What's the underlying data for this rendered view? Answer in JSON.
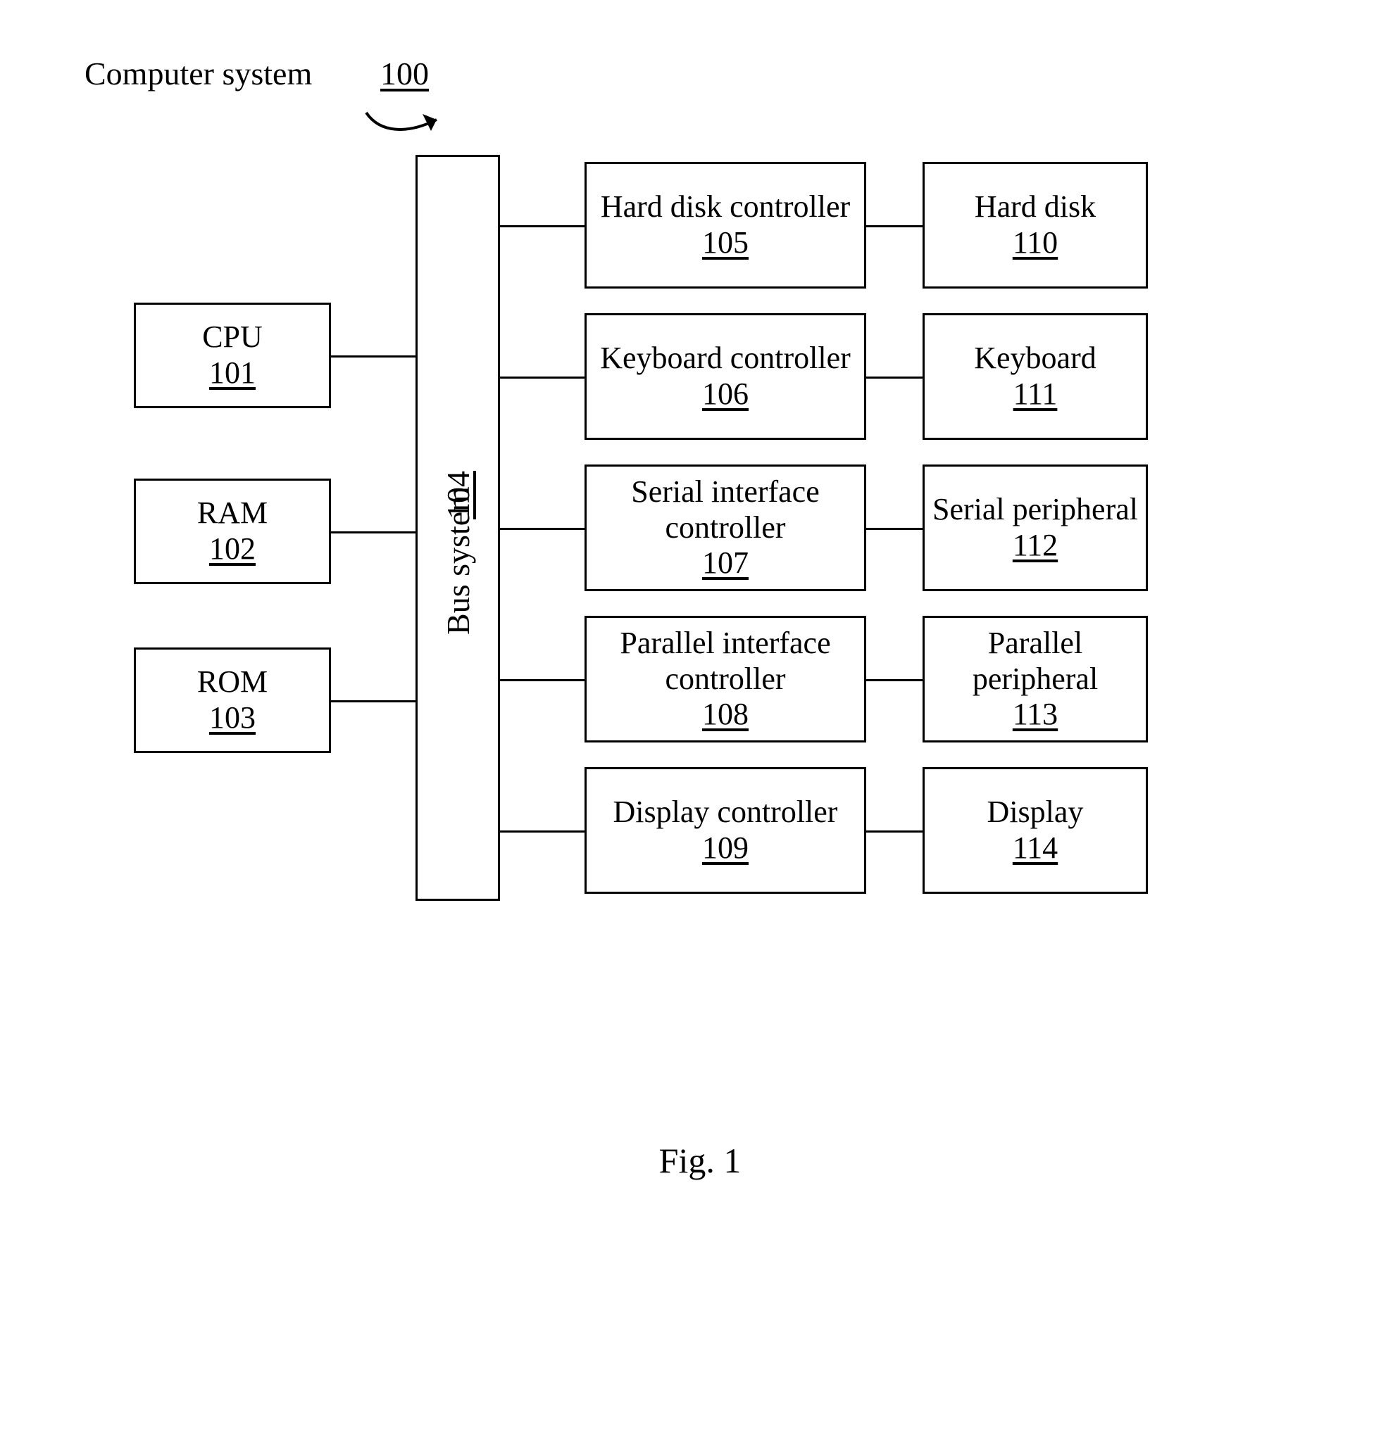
{
  "title": {
    "label": "Computer system",
    "num": "100"
  },
  "bus": {
    "label": "Bus system",
    "num": "104"
  },
  "left": {
    "cpu": {
      "label": "CPU",
      "num": "101"
    },
    "ram": {
      "label": "RAM",
      "num": "102"
    },
    "rom": {
      "label": "ROM",
      "num": "103"
    }
  },
  "controllers": {
    "hdd": {
      "label": "Hard disk controller",
      "num": "105"
    },
    "keyboard": {
      "label": "Keyboard controller",
      "num": "106"
    },
    "serial": {
      "label": "Serial interface controller",
      "num": "107"
    },
    "parallel": {
      "label": "Parallel interface controller",
      "num": "108"
    },
    "display": {
      "label": "Display controller",
      "num": "109"
    }
  },
  "devices": {
    "hdd": {
      "label": "Hard disk",
      "num": "110"
    },
    "keyboard": {
      "label": "Keyboard",
      "num": "111"
    },
    "serial": {
      "label": "Serial peripheral",
      "num": "112"
    },
    "parallel": {
      "label": "Parallel peripheral",
      "num": "113"
    },
    "display": {
      "label": "Display",
      "num": "114"
    }
  },
  "caption": "Fig. 1"
}
